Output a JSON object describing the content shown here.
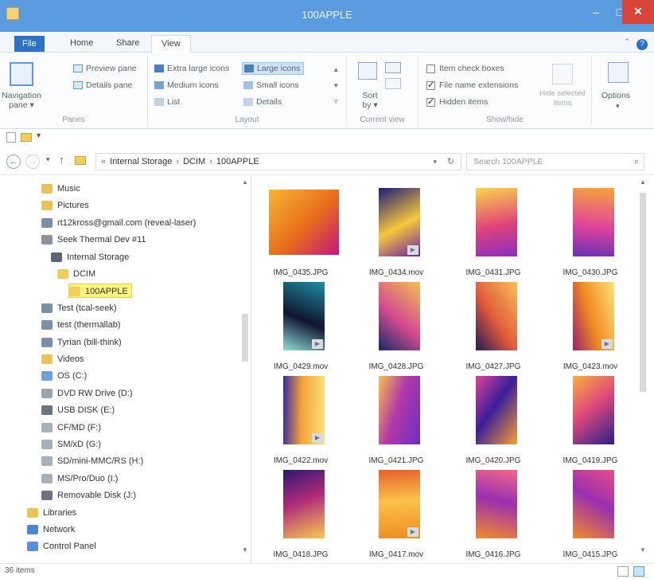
{
  "window": {
    "title": "100APPLE",
    "min": "–",
    "max": "□",
    "close": "✕"
  },
  "tabs": {
    "file": "File",
    "home": "Home",
    "share": "Share",
    "view": "View"
  },
  "ribbon": {
    "panes": {
      "navigation_pane": "Navigation pane ▾",
      "preview_pane": "Preview pane",
      "details_pane": "Details pane",
      "group_label": "Panes"
    },
    "layout": {
      "extra_large": "Extra large icons",
      "large": "Large icons",
      "medium": "Medium icons",
      "small": "Small icons",
      "list": "List",
      "details": "Details",
      "group_label": "Layout"
    },
    "current_view": {
      "sort_by": "Sort by ▾",
      "group_label": "Current view"
    },
    "show_hide": {
      "item_check_boxes": "Item check boxes",
      "item_check_boxes_checked": false,
      "file_name_extensions": "File name extensions",
      "file_name_extensions_checked": true,
      "hidden_items": "Hidden items",
      "hidden_items_checked": true,
      "hide_selected": "Hide selected items",
      "group_label": "Show/hide"
    },
    "options": "Options"
  },
  "address": {
    "parts": [
      "Internal Storage",
      "DCIM",
      "100APPLE"
    ],
    "search_placeholder": "Search 100APPLE"
  },
  "nav": {
    "items": [
      {
        "label": "Music",
        "icon": "music-folder-icon",
        "indent": 1
      },
      {
        "label": "Pictures",
        "icon": "pictures-folder-icon",
        "indent": 1
      },
      {
        "label": "rt12kross@gmail.com (reveal-laser)",
        "icon": "network-user-icon",
        "indent": 1
      },
      {
        "label": "Seek Thermal Dev #11",
        "icon": "device-icon",
        "indent": 1
      },
      {
        "label": "Internal Storage",
        "icon": "storage-icon",
        "indent": 2
      },
      {
        "label": "DCIM",
        "icon": "folder-icon",
        "indent": 3
      },
      {
        "label": "100APPLE",
        "icon": "folder-icon",
        "indent": 4,
        "selected": true
      },
      {
        "label": "Test (tcal-seek)",
        "icon": "network-user-icon",
        "indent": 1
      },
      {
        "label": "test (thermallab)",
        "icon": "network-user-icon",
        "indent": 1
      },
      {
        "label": "Tyrian (bill-think)",
        "icon": "network-user-icon",
        "indent": 1
      },
      {
        "label": "Videos",
        "icon": "videos-folder-icon",
        "indent": 1
      },
      {
        "label": "OS (C:)",
        "icon": "drive-icon",
        "indent": 1
      },
      {
        "label": "DVD RW Drive (D:)",
        "icon": "dvd-drive-icon",
        "indent": 1
      },
      {
        "label": "USB DISK (E:)",
        "icon": "usb-drive-icon",
        "indent": 1
      },
      {
        "label": "CF/MD (F:)",
        "icon": "card-drive-icon",
        "indent": 1
      },
      {
        "label": "SM/xD (G:)",
        "icon": "card-drive-icon",
        "indent": 1
      },
      {
        "label": "SD/mini-MMC/RS (H:)",
        "icon": "card-drive-icon",
        "indent": 1
      },
      {
        "label": "MS/Pro/Duo (I:)",
        "icon": "card-drive-icon",
        "indent": 1
      },
      {
        "label": "Removable Disk (J:)",
        "icon": "usb-drive-icon",
        "indent": 1
      },
      {
        "label": "Libraries",
        "icon": "libraries-icon",
        "indent": 0
      },
      {
        "label": "Network",
        "icon": "network-icon",
        "indent": 0
      },
      {
        "label": "Control Panel",
        "icon": "control-panel-icon",
        "indent": 0
      }
    ]
  },
  "files": [
    {
      "name": "IMG_0435.JPG",
      "video": false,
      "c1": "#f7b733",
      "c2": "#e86a1c",
      "c3": "#c2187a"
    },
    {
      "name": "IMG_0434.mov",
      "video": true,
      "c1": "#1b1b7a",
      "c2": "#f5c83b",
      "c3": "#6d1fa6"
    },
    {
      "name": "IMG_0431.JPG",
      "video": false,
      "c1": "#f9d54a",
      "c2": "#e1427a",
      "c3": "#8a2fc0"
    },
    {
      "name": "IMG_0430.JPG",
      "video": false,
      "c1": "#f6a43a",
      "c2": "#e0459b",
      "c3": "#6b2fb5"
    },
    {
      "name": "IMG_0429.mov",
      "video": true,
      "c1": "#1f8fa3",
      "c2": "#101430",
      "c3": "#8ee0d8"
    },
    {
      "name": "IMG_0428.JPG",
      "video": false,
      "c1": "#f5c050",
      "c2": "#d34a8e",
      "c3": "#152a66"
    },
    {
      "name": "IMG_0427.JPG",
      "video": false,
      "c1": "#f7c15a",
      "c2": "#e05a3a",
      "c3": "#241a58"
    },
    {
      "name": "IMG_0423.mov",
      "video": true,
      "c1": "#fbe27a",
      "c2": "#f08a20",
      "c3": "#9a1f6a"
    },
    {
      "name": "IMG_0422.mov",
      "video": true,
      "c1": "#fbe07a",
      "c2": "#f3a43a",
      "c3": "#3a2aa0"
    },
    {
      "name": "IMG_0421.JPG",
      "video": false,
      "c1": "#6a2fc0",
      "c2": "#b43aa8",
      "c3": "#f6c24a"
    },
    {
      "name": "IMG_0420.JPG",
      "video": false,
      "c1": "#f6a030",
      "c2": "#3a1f9a",
      "c3": "#e0409a"
    },
    {
      "name": "IMG_0419.JPG",
      "video": false,
      "c1": "#2a1f8a",
      "c2": "#e04a7a",
      "c3": "#f7b03a"
    },
    {
      "name": "IMG_0418.JPG",
      "video": false,
      "c1": "#f9c94e",
      "c2": "#b02a7a",
      "c3": "#2a1a70"
    },
    {
      "name": "IMG_0417.mov",
      "video": true,
      "c1": "#f08a20",
      "c2": "#f9c24a",
      "c3": "#e8602a"
    },
    {
      "name": "IMG_0416.JPG",
      "video": false,
      "c1": "#f38a2a",
      "c2": "#9a2fb0",
      "c3": "#f06a8a"
    },
    {
      "name": "IMG_0415.JPG",
      "video": false,
      "c1": "#f38a2a",
      "c2": "#9a2fb0",
      "c3": "#e8508a"
    }
  ],
  "status": {
    "item_count": "36 items"
  },
  "colors": {
    "titlebar": "#5b9be0",
    "file_tab": "#2c72c7",
    "close": "#d9443b",
    "selection": "#fbf580"
  }
}
